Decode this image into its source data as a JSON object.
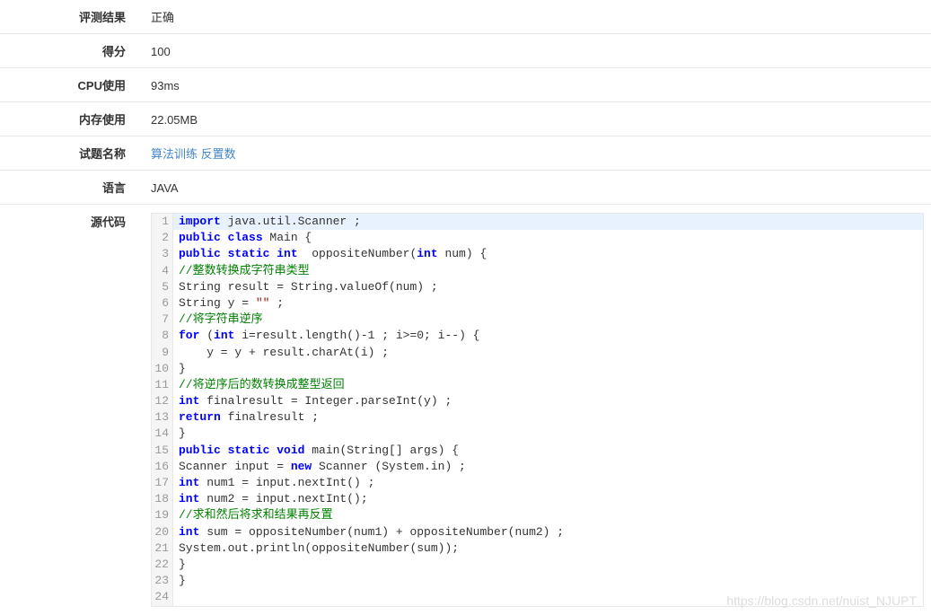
{
  "rows": {
    "result_label": "评测结果",
    "result_value": "正确",
    "score_label": "得分",
    "score_value": "100",
    "cpu_label": "CPU使用",
    "cpu_value": "93ms",
    "mem_label": "内存使用",
    "mem_value": "22.05MB",
    "problem_label": "试题名称",
    "problem_value": "算法训练 反置数",
    "lang_label": "语言",
    "lang_value": "JAVA",
    "source_label": "源代码"
  },
  "code_lines": [
    {
      "n": 1,
      "segs": [
        {
          "t": "import",
          "c": "kw"
        },
        {
          "t": " java.util.Scanner ;"
        }
      ],
      "hl": true
    },
    {
      "n": 2,
      "segs": [
        {
          "t": "public class",
          "c": "kw"
        },
        {
          "t": " Main {"
        }
      ]
    },
    {
      "n": 3,
      "segs": [
        {
          "t": "public static int",
          "c": "kw"
        },
        {
          "t": "  oppositeNumber("
        },
        {
          "t": "int",
          "c": "kw"
        },
        {
          "t": " num) {"
        }
      ]
    },
    {
      "n": 4,
      "segs": [
        {
          "t": "//整数转换成字符串类型",
          "c": "cmt"
        }
      ]
    },
    {
      "n": 5,
      "segs": [
        {
          "t": "String result = String.valueOf(num) ;"
        }
      ]
    },
    {
      "n": 6,
      "segs": [
        {
          "t": "String y = "
        },
        {
          "t": "\"\"",
          "c": "str"
        },
        {
          "t": " ;"
        }
      ]
    },
    {
      "n": 7,
      "segs": [
        {
          "t": "//将字符串逆序",
          "c": "cmt"
        }
      ]
    },
    {
      "n": 8,
      "segs": [
        {
          "t": "for",
          "c": "kw"
        },
        {
          "t": " ("
        },
        {
          "t": "int",
          "c": "kw"
        },
        {
          "t": " i=result.length()-1 ; i>=0; i--) {"
        }
      ]
    },
    {
      "n": 9,
      "segs": [
        {
          "t": "    y = y + result.charAt(i) ;"
        }
      ]
    },
    {
      "n": 10,
      "segs": [
        {
          "t": "}"
        }
      ]
    },
    {
      "n": 11,
      "segs": [
        {
          "t": "//将逆序后的数转换成整型返回",
          "c": "cmt"
        }
      ]
    },
    {
      "n": 12,
      "segs": [
        {
          "t": "int",
          "c": "kw"
        },
        {
          "t": " finalresult = Integer.parseInt(y) ;"
        }
      ]
    },
    {
      "n": 13,
      "segs": [
        {
          "t": "return",
          "c": "kw"
        },
        {
          "t": " finalresult ;"
        }
      ]
    },
    {
      "n": 14,
      "segs": [
        {
          "t": "}"
        }
      ]
    },
    {
      "n": 15,
      "segs": [
        {
          "t": "public static void",
          "c": "kw"
        },
        {
          "t": " main(String[] args) {"
        }
      ]
    },
    {
      "n": 16,
      "segs": [
        {
          "t": "Scanner input = "
        },
        {
          "t": "new",
          "c": "kw"
        },
        {
          "t": " Scanner (System.in) ;"
        }
      ]
    },
    {
      "n": 17,
      "segs": [
        {
          "t": "int",
          "c": "kw"
        },
        {
          "t": " num1 = input.nextInt() ;"
        }
      ]
    },
    {
      "n": 18,
      "segs": [
        {
          "t": "int",
          "c": "kw"
        },
        {
          "t": " num2 = input.nextInt();"
        }
      ]
    },
    {
      "n": 19,
      "segs": [
        {
          "t": "//求和然后将求和结果再反置",
          "c": "cmt"
        }
      ]
    },
    {
      "n": 20,
      "segs": [
        {
          "t": "int",
          "c": "kw"
        },
        {
          "t": " sum = oppositeNumber(num1) + oppositeNumber(num2) ;"
        }
      ]
    },
    {
      "n": 21,
      "segs": [
        {
          "t": "System.out.println(oppositeNumber(sum));"
        }
      ]
    },
    {
      "n": 22,
      "segs": [
        {
          "t": "}"
        }
      ]
    },
    {
      "n": 23,
      "segs": [
        {
          "t": "}"
        }
      ]
    },
    {
      "n": 24,
      "segs": [
        {
          "t": ""
        }
      ]
    }
  ],
  "watermark": "https://blog.csdn.net/nuist_NJUPT"
}
